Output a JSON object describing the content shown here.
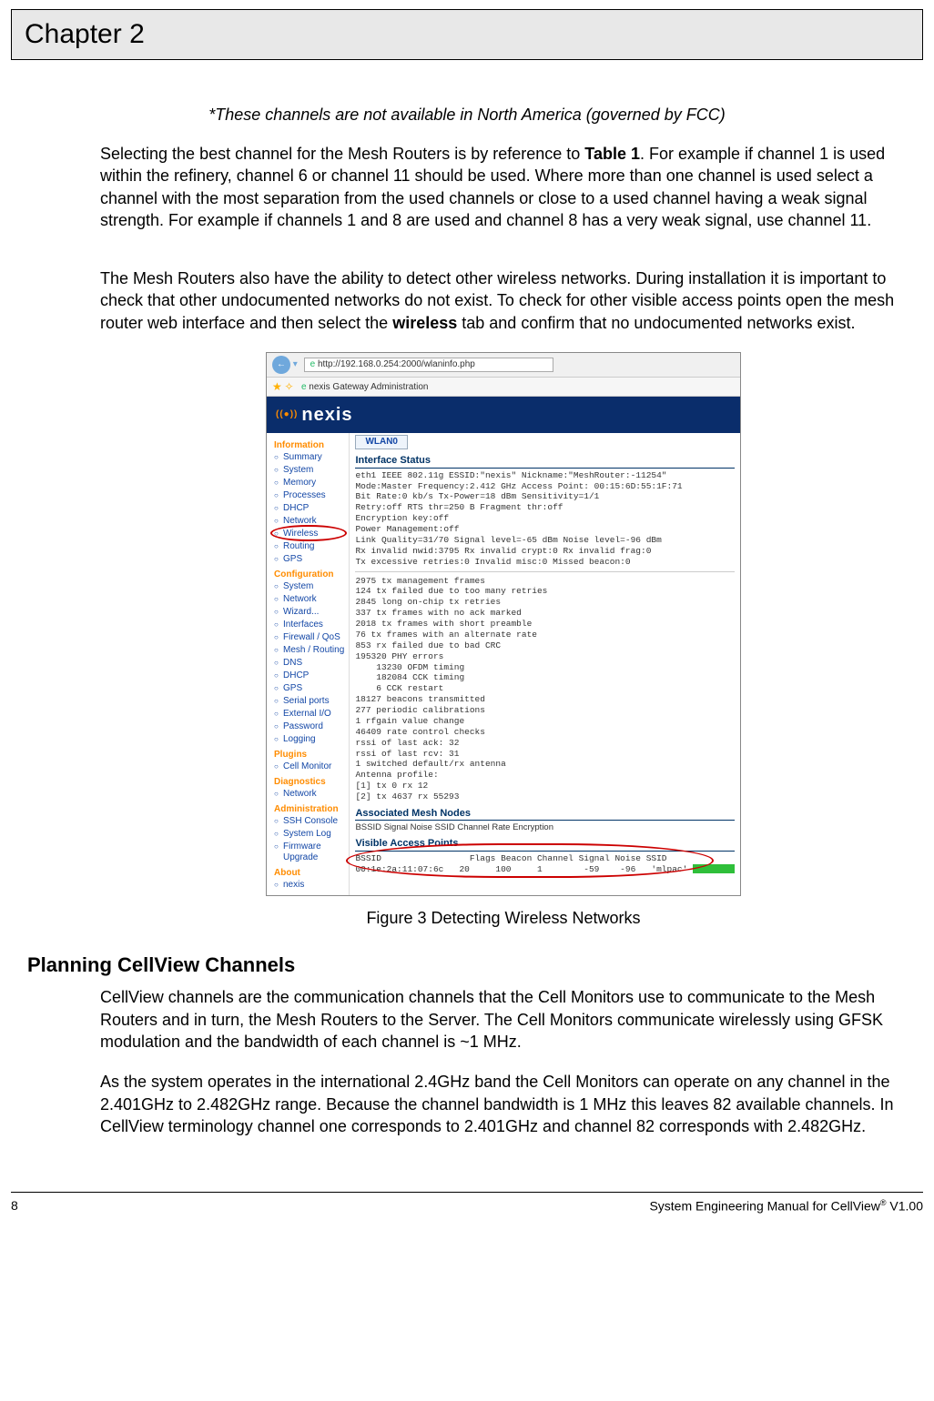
{
  "chapter": {
    "title": "Chapter 2"
  },
  "note": "*These channels are not available in North America (governed by FCC)",
  "p1_a": "Selecting the best channel for the Mesh Routers is by reference to ",
  "p1_b": "Table 1",
  "p1_c": ". For example if channel 1 is used within the refinery, channel 6 or channel 11 should be used. Where more than one channel is used select a channel with the most separation from the used channels or close to a used channel having a weak signal strength. For example if channels 1 and 8 are used and channel 8 has a very weak signal, use channel 11.",
  "p2_a": "The Mesh Routers also have the ability to detect other wireless networks. During installation it is important to check that other undocumented networks do not exist.  To check for other visible access points open the mesh router web interface and then select the ",
  "p2_b": "wireless",
  "p2_c": " tab and confirm that no undocumented networks exist.",
  "browser": {
    "url": "http://192.168.0.254:2000/wlaninfo.php",
    "tab_title": "nexis Gateway Administration",
    "brand": "nexis",
    "wlan_tab": "WLAN0",
    "side": {
      "information": "Information",
      "info_items": [
        "Summary",
        "System",
        "Memory",
        "Processes",
        "DHCP",
        "Network",
        "Wireless",
        "Routing",
        "GPS"
      ],
      "configuration": "Configuration",
      "config_items": [
        "System",
        "Network",
        "Wizard...",
        "Interfaces",
        "Firewall / QoS",
        "Mesh / Routing",
        "DNS",
        "DHCP",
        "GPS",
        "Serial ports",
        "External I/O",
        "Password",
        "Logging"
      ],
      "plugins": "Plugins",
      "plugin_items": [
        "Cell Monitor"
      ],
      "diagnostics": "Diagnostics",
      "diag_items": [
        "Network"
      ],
      "administration": "Administration",
      "admin_items": [
        "SSH Console",
        "System Log",
        "Firmware Upgrade"
      ],
      "about": "About",
      "about_items": [
        "nexis"
      ]
    },
    "interface_status": {
      "heading": "Interface Status",
      "lines": "eth1 IEEE 802.11g ESSID:\"nexis\" Nickname:\"MeshRouter:-11254\"\nMode:Master Frequency:2.412 GHz Access Point: 00:15:6D:55:1F:71\nBit Rate:0 kb/s Tx-Power=18 dBm Sensitivity=1/1\nRetry:off RTS thr=250 B Fragment thr:off\nEncryption key:off\nPower Management:off\nLink Quality=31/70 Signal level=-65 dBm Noise level=-96 dBm\nRx invalid nwid:3795 Rx invalid crypt:0 Rx invalid frag:0\nTx excessive retries:0 Invalid misc:0 Missed beacon:0"
    },
    "stats": "2975 tx management frames\n124 tx failed due to too many retries\n2845 long on-chip tx retries\n337 tx frames with no ack marked\n2018 tx frames with short preamble\n76 tx frames with an alternate rate\n853 rx failed due to bad CRC\n195320 PHY errors\n    13230 OFDM timing\n    182084 CCK timing\n    6 CCK restart\n18127 beacons transmitted\n277 periodic calibrations\n1 rfgain value change\n46409 rate control checks\nrssi of last ack: 32\nrssi of last rcv: 31\n1 switched default/rx antenna\nAntenna profile:\n[1] tx 0 rx 12\n[2] tx 4637 rx 55293",
    "assoc_heading": "Associated Mesh Nodes",
    "assoc_cols": "BSSID  Signal  Noise  SSID  Channel  Rate  Encryption",
    "vap_heading": "Visible Access Points",
    "vap_cols": "BSSID                 Flags Beacon Channel Signal Noise SSID",
    "vap_row": "00:1e:2a:11:07:6c   20     100     1        -59    -96   'mlpac'"
  },
  "figure_caption": "Figure 3  Detecting Wireless Networks",
  "planning": {
    "heading": "Planning CellView Channels",
    "p1": "CellView channels are the communication channels that the Cell Monitors use to communicate to the Mesh Routers and in turn, the Mesh Routers to the Server. The Cell Monitors communicate wirelessly using GFSK modulation and the bandwidth of each channel is ~1 MHz.",
    "p2": "As the system operates in the international 2.4GHz band the Cell Monitors can operate on any channel in the 2.401GHz to 2.482GHz range. Because the channel bandwidth is 1 MHz this leaves 82 available channels. In CellView terminology channel one corresponds to 2.401GHz and channel 82 corresponds with 2.482GHz."
  },
  "footer": {
    "page": "8",
    "right_a": "System Engineering Manual for CellView",
    "right_b": "®",
    "right_c": " V1.00"
  }
}
